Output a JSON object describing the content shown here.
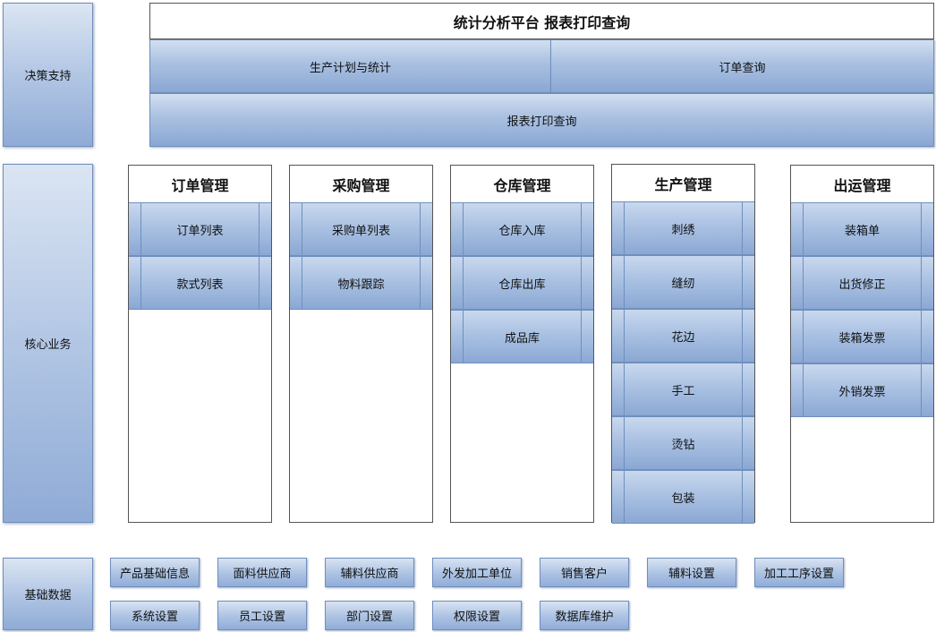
{
  "left": {
    "decision": "决策支持",
    "core": "核心业务",
    "basic": "基础数据"
  },
  "top": {
    "title": "统计分析平台  报表打印查询",
    "plan": "生产计划与统计",
    "order_query": "订单查询",
    "report": "报表打印查询"
  },
  "columns": [
    {
      "title": "订单管理",
      "items": [
        "订单列表",
        "款式列表"
      ]
    },
    {
      "title": "采购管理",
      "items": [
        "采购单列表",
        "物料跟踪"
      ]
    },
    {
      "title": "仓库管理",
      "items": [
        "仓库入库",
        "仓库出库",
        "成品库"
      ]
    },
    {
      "title": "生产管理",
      "items": [
        "刺绣",
        "缝纫",
        "花边",
        "手工",
        "烫钻",
        "包装"
      ]
    },
    {
      "title": "出运管理",
      "items": [
        "装箱单",
        "出货修正",
        "装箱发票",
        "外销发票"
      ]
    }
  ],
  "basic_row1": [
    "产品基础信息",
    "面料供应商",
    "辅料供应商",
    "外发加工单位",
    "销售客户",
    "辅料设置",
    "加工工序设置"
  ],
  "basic_row2": [
    "系统设置",
    "员工设置",
    "部门设置",
    "权限设置",
    "数据库维护"
  ]
}
